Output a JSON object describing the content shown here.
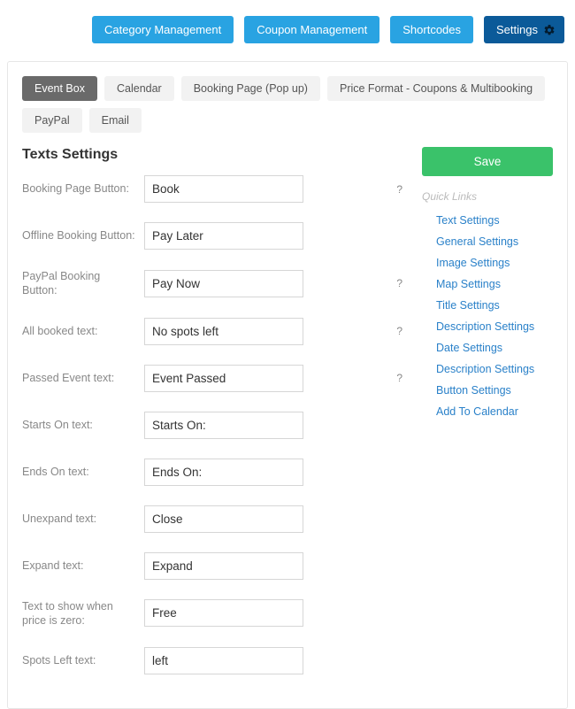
{
  "topnav": {
    "category": "Category Management",
    "coupon": "Coupon Management",
    "shortcodes": "Shortcodes",
    "settings": "Settings"
  },
  "tabs": {
    "event_box": "Event Box",
    "calendar": "Calendar",
    "booking_page": "Booking Page (Pop up)",
    "price_format": "Price Format - Coupons & Multibooking",
    "paypal": "PayPal",
    "email": "Email"
  },
  "section_title": "Texts Settings",
  "fields": {
    "booking_page_button": {
      "label": "Booking Page Button:",
      "value": "Book",
      "help": "?"
    },
    "offline_booking_button": {
      "label": "Offline Booking Button:",
      "value": "Pay Later"
    },
    "paypal_booking_button": {
      "label": "PayPal Booking Button:",
      "value": "Pay Now",
      "help": "?"
    },
    "all_booked_text": {
      "label": "All booked text:",
      "value": "No spots left",
      "help": "?"
    },
    "passed_event_text": {
      "label": "Passed Event text:",
      "value": "Event Passed",
      "help": "?"
    },
    "starts_on_text": {
      "label": "Starts On text:",
      "value": "Starts On:"
    },
    "ends_on_text": {
      "label": "Ends On text:",
      "value": "Ends On:"
    },
    "unexpand_text": {
      "label": "Unexpand text:",
      "value": "Close"
    },
    "expand_text": {
      "label": "Expand text:",
      "value": "Expand"
    },
    "price_zero_text": {
      "label": "Text to show when price is zero:",
      "value": "Free"
    },
    "spots_left_text": {
      "label": "Spots Left text:",
      "value": "left"
    }
  },
  "save_label": "Save",
  "quick_links_title": "Quick Links",
  "quick_links": [
    "Text Settings",
    "General Settings",
    "Image Settings",
    "Map Settings",
    "Title Settings",
    "Description Settings",
    "Date Settings",
    "Description Settings",
    "Button Settings",
    "Add To Calendar"
  ]
}
